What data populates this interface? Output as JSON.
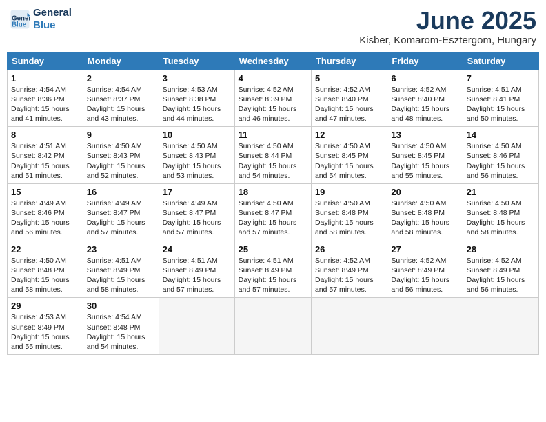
{
  "header": {
    "logo_line1": "General",
    "logo_line2": "Blue",
    "title": "June 2025",
    "location": "Kisber, Komarom-Esztergom, Hungary"
  },
  "weekdays": [
    "Sunday",
    "Monday",
    "Tuesday",
    "Wednesday",
    "Thursday",
    "Friday",
    "Saturday"
  ],
  "weeks": [
    [
      {
        "day": 1,
        "sunrise": "4:54 AM",
        "sunset": "8:36 PM",
        "daylight": "15 hours and 41 minutes."
      },
      {
        "day": 2,
        "sunrise": "4:54 AM",
        "sunset": "8:37 PM",
        "daylight": "15 hours and 43 minutes."
      },
      {
        "day": 3,
        "sunrise": "4:53 AM",
        "sunset": "8:38 PM",
        "daylight": "15 hours and 44 minutes."
      },
      {
        "day": 4,
        "sunrise": "4:52 AM",
        "sunset": "8:39 PM",
        "daylight": "15 hours and 46 minutes."
      },
      {
        "day": 5,
        "sunrise": "4:52 AM",
        "sunset": "8:40 PM",
        "daylight": "15 hours and 47 minutes."
      },
      {
        "day": 6,
        "sunrise": "4:52 AM",
        "sunset": "8:40 PM",
        "daylight": "15 hours and 48 minutes."
      },
      {
        "day": 7,
        "sunrise": "4:51 AM",
        "sunset": "8:41 PM",
        "daylight": "15 hours and 50 minutes."
      }
    ],
    [
      {
        "day": 8,
        "sunrise": "4:51 AM",
        "sunset": "8:42 PM",
        "daylight": "15 hours and 51 minutes."
      },
      {
        "day": 9,
        "sunrise": "4:50 AM",
        "sunset": "8:43 PM",
        "daylight": "15 hours and 52 minutes."
      },
      {
        "day": 10,
        "sunrise": "4:50 AM",
        "sunset": "8:43 PM",
        "daylight": "15 hours and 53 minutes."
      },
      {
        "day": 11,
        "sunrise": "4:50 AM",
        "sunset": "8:44 PM",
        "daylight": "15 hours and 54 minutes."
      },
      {
        "day": 12,
        "sunrise": "4:50 AM",
        "sunset": "8:45 PM",
        "daylight": "15 hours and 54 minutes."
      },
      {
        "day": 13,
        "sunrise": "4:50 AM",
        "sunset": "8:45 PM",
        "daylight": "15 hours and 55 minutes."
      },
      {
        "day": 14,
        "sunrise": "4:50 AM",
        "sunset": "8:46 PM",
        "daylight": "15 hours and 56 minutes."
      }
    ],
    [
      {
        "day": 15,
        "sunrise": "4:49 AM",
        "sunset": "8:46 PM",
        "daylight": "15 hours and 56 minutes."
      },
      {
        "day": 16,
        "sunrise": "4:49 AM",
        "sunset": "8:47 PM",
        "daylight": "15 hours and 57 minutes."
      },
      {
        "day": 17,
        "sunrise": "4:49 AM",
        "sunset": "8:47 PM",
        "daylight": "15 hours and 57 minutes."
      },
      {
        "day": 18,
        "sunrise": "4:50 AM",
        "sunset": "8:47 PM",
        "daylight": "15 hours and 57 minutes."
      },
      {
        "day": 19,
        "sunrise": "4:50 AM",
        "sunset": "8:48 PM",
        "daylight": "15 hours and 58 minutes."
      },
      {
        "day": 20,
        "sunrise": "4:50 AM",
        "sunset": "8:48 PM",
        "daylight": "15 hours and 58 minutes."
      },
      {
        "day": 21,
        "sunrise": "4:50 AM",
        "sunset": "8:48 PM",
        "daylight": "15 hours and 58 minutes."
      }
    ],
    [
      {
        "day": 22,
        "sunrise": "4:50 AM",
        "sunset": "8:48 PM",
        "daylight": "15 hours and 58 minutes."
      },
      {
        "day": 23,
        "sunrise": "4:51 AM",
        "sunset": "8:49 PM",
        "daylight": "15 hours and 58 minutes."
      },
      {
        "day": 24,
        "sunrise": "4:51 AM",
        "sunset": "8:49 PM",
        "daylight": "15 hours and 57 minutes."
      },
      {
        "day": 25,
        "sunrise": "4:51 AM",
        "sunset": "8:49 PM",
        "daylight": "15 hours and 57 minutes."
      },
      {
        "day": 26,
        "sunrise": "4:52 AM",
        "sunset": "8:49 PM",
        "daylight": "15 hours and 57 minutes."
      },
      {
        "day": 27,
        "sunrise": "4:52 AM",
        "sunset": "8:49 PM",
        "daylight": "15 hours and 56 minutes."
      },
      {
        "day": 28,
        "sunrise": "4:52 AM",
        "sunset": "8:49 PM",
        "daylight": "15 hours and 56 minutes."
      }
    ],
    [
      {
        "day": 29,
        "sunrise": "4:53 AM",
        "sunset": "8:49 PM",
        "daylight": "15 hours and 55 minutes."
      },
      {
        "day": 30,
        "sunrise": "4:54 AM",
        "sunset": "8:48 PM",
        "daylight": "15 hours and 54 minutes."
      },
      null,
      null,
      null,
      null,
      null
    ]
  ]
}
